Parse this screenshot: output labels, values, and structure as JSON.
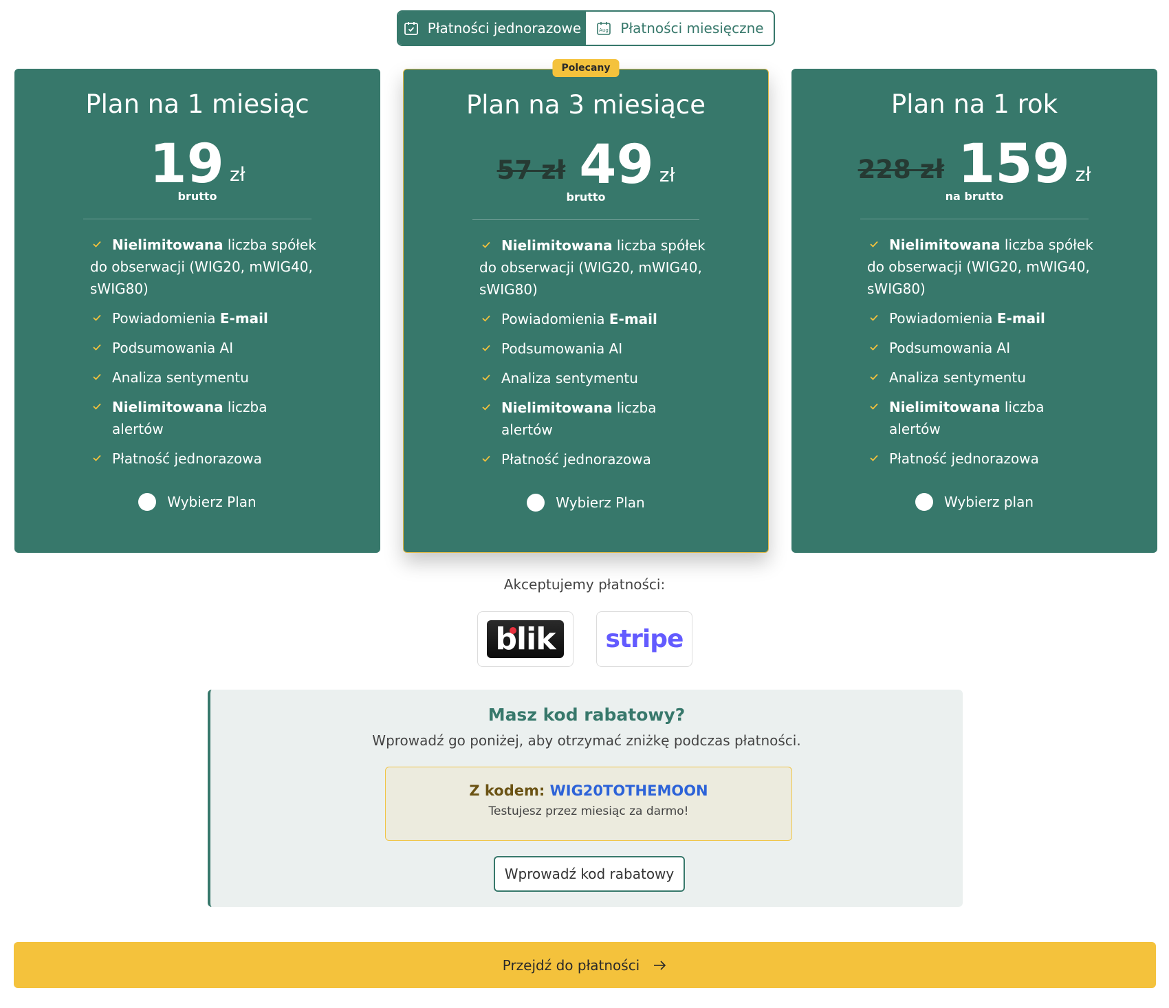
{
  "toggle": {
    "one_time_label": "Płatności jednorazowe",
    "monthly_label": "Płatności miesięczne",
    "calendar_badge": "Aug"
  },
  "plans": [
    {
      "title": "Plan na 1 miesiąc",
      "old_price": "",
      "price": "19",
      "currency": "zł",
      "price_note": "brutto",
      "badge": "",
      "choose_label": "Wybierz Plan"
    },
    {
      "title": "Plan na 3 miesiące",
      "old_price": "57 zł",
      "price": "49",
      "currency": "zł",
      "price_note": "brutto",
      "badge": "Polecany",
      "choose_label": "Wybierz Plan"
    },
    {
      "title": "Plan na 1 rok",
      "old_price": "228 zł",
      "price": "159",
      "currency": "zł",
      "price_note": "na brutto",
      "badge": "",
      "choose_label": "Wybierz plan"
    }
  ],
  "features": {
    "f1_bold": "Nielimitowana",
    "f1_first": " liczba spółek",
    "f1_rest": "do obserwacji (WIG20, mWIG40, sWIG80)",
    "f2_text": "Powiadomienia ",
    "f2_bold": "E-mail",
    "f3_text": "Podsumowania AI",
    "f4_text": "Analiza sentymentu",
    "f5_bold": "Nielimitowana",
    "f5_text": " liczba alertów",
    "f6_text": "Płatność jednorazowa"
  },
  "payments": {
    "label": "Akceptujemy płatności:",
    "blik_text": "blik",
    "stripe_text": "stripe"
  },
  "discount": {
    "title": "Masz kod rabatowy?",
    "subtitle": "Wprowadź go poniżej, aby otrzymać zniżkę podczas płatności.",
    "code_prefix": "Z kodem: ",
    "code": "WIG20TOTHEMOON",
    "code_note": "Testujesz przez miesiąc za darmo!",
    "enter_label": "Wprowadź kod rabatowy"
  },
  "proceed_label": "Przejdź do płatności",
  "colors": {
    "primary": "#37786b",
    "accent": "#f4c23c",
    "link": "#2d63d8"
  }
}
